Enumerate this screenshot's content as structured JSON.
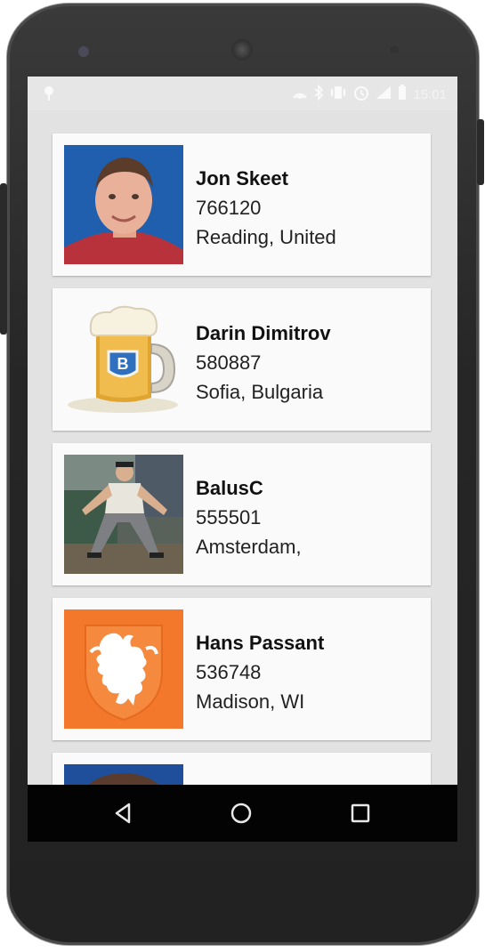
{
  "statusbar": {
    "time": "15:01",
    "icons": [
      "location-pin-icon",
      "nfc-icon",
      "bluetooth-icon",
      "vibrate-icon",
      "alarm-icon",
      "signal-icon",
      "battery-icon"
    ]
  },
  "users": [
    {
      "name": "Jon Skeet",
      "reputation": "766120",
      "location": "Reading, United",
      "avatar": "portrait-photo"
    },
    {
      "name": "Darin Dimitrov",
      "reputation": "580887",
      "location": "Sofia, Bulgaria",
      "avatar": "beer-mug-icon"
    },
    {
      "name": "BalusC",
      "reputation": "555501",
      "location": "Amsterdam,",
      "avatar": "action-photo"
    },
    {
      "name": "Hans Passant",
      "reputation": "536748",
      "location": "Madison, WI",
      "avatar": "lion-emblem"
    }
  ],
  "navbar": {
    "buttons": [
      "back-icon",
      "home-icon",
      "recents-icon"
    ]
  },
  "colors": {
    "screen_bg": "#e2e2e2",
    "card_bg": "#fafafa",
    "navbar_bg": "#030303",
    "avatar_blue": "#1f5fae",
    "avatar_orange": "#f3782c"
  }
}
